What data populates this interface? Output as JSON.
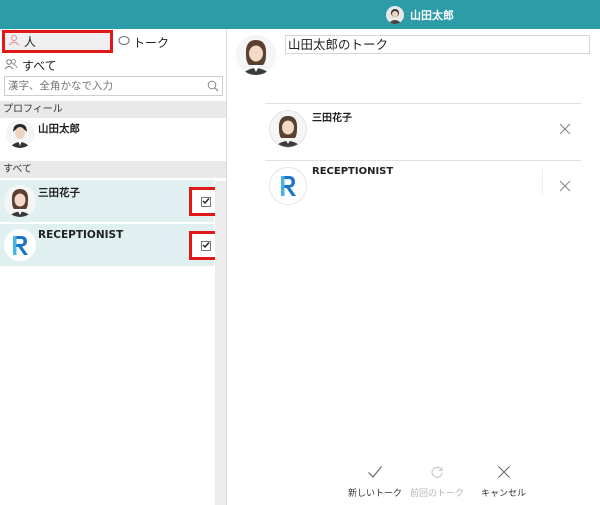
{
  "header": {
    "user_name": "山田太郎"
  },
  "left": {
    "tabs": {
      "people": "人",
      "talk": "トーク"
    },
    "all_label": "すべて",
    "search": {
      "placeholder": "漢字、全角かなで入力"
    },
    "profile_section": "プロフィール",
    "profile_name": "山田太郎",
    "all_section": "すべて",
    "contacts": [
      {
        "name": "三田花子",
        "checked": true
      },
      {
        "name": "RECEPTIONIST",
        "checked": true
      }
    ]
  },
  "right": {
    "talk_name": "山田太郎のトーク",
    "members": [
      {
        "name": "三田花子"
      },
      {
        "name": "RECEPTIONIST"
      }
    ],
    "actions": {
      "new_talk": "新しいトーク",
      "previous_talk": "前回のトーク",
      "cancel": "キャンセル"
    }
  },
  "colors": {
    "header": "#2b9ca8",
    "selected_row": "#e0f0f1",
    "highlight": "#e01818",
    "brand": "#1a74c9"
  }
}
